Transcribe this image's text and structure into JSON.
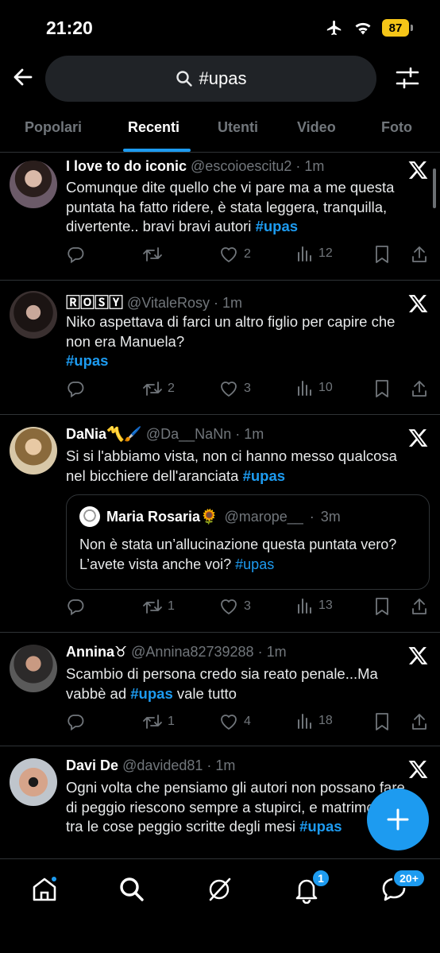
{
  "status": {
    "time": "21:20",
    "battery": "87"
  },
  "search": {
    "query": "#upas"
  },
  "tabs": [
    "Popolari",
    "Recenti",
    "Utenti",
    "Video",
    "Foto"
  ],
  "tweets": [
    {
      "name": "I love to do iconic",
      "handle": "@escoioescitu2",
      "time": "1m",
      "text": "Comunque dite quello che vi pare ma a me questa puntata ha fatto ridere, è stata leggera, tranquilla, divertente.. bravi bravi autori",
      "hashtag": "#upas",
      "retweets": "",
      "likes": "2",
      "views": "12"
    },
    {
      "name": "🅁🄾🅂🅈",
      "handle": "@VitaleRosy",
      "time": "1m",
      "text": "Niko aspettava di farci un altro figlio per capire che non era Manuela?",
      "hashtag": "#upas",
      "retweets": "2",
      "likes": "3",
      "views": "10"
    },
    {
      "name": "DaNia〽️🖌️",
      "handle": "@Da__NaNn",
      "time": "1m",
      "text": "Si si l'abbiamo vista, non ci hanno messo qualcosa nel bicchiere dell'aranciata",
      "hashtag": "#upas",
      "retweets": "1",
      "likes": "3",
      "views": "13",
      "quote": {
        "name": "Maria Rosaria🌻",
        "handle": "@marope__",
        "time": "3m",
        "text": "Non è stata un’allucinazione questa puntata vero? L’avete vista anche voi?",
        "hashtag": "#upas"
      }
    },
    {
      "name": "Annina♉",
      "handle": "@Annina82739288",
      "time": "1m",
      "text_before": "Scambio di persona credo sia reato penale...Ma vabbè ad",
      "hashtag": "#upas",
      "text_after": "vale tutto",
      "retweets": "1",
      "likes": "4",
      "views": "18"
    },
    {
      "name": "Davi De",
      "handle": "@davided81",
      "time": "1m",
      "text": "Ogni volta che pensiamo gli autori non possano fare di peggio riescono sempre a stupirci, e matrimonio tra le cose peggio scritte degli mesi",
      "hashtag": "#upas"
    }
  ],
  "nav": {
    "notifications_badge": "1",
    "messages_badge": "20+"
  },
  "colors": {
    "accent": "#1d9bf0",
    "background": "#000000",
    "muted": "#71767b",
    "battery": "#f5c518"
  }
}
